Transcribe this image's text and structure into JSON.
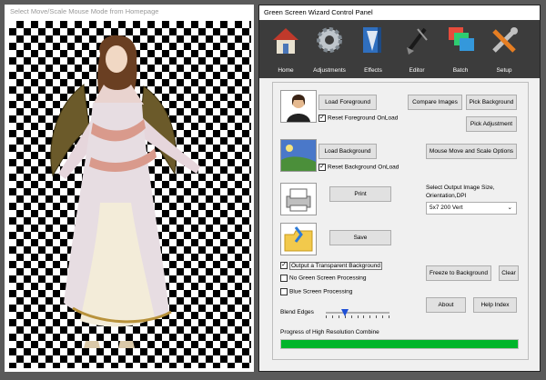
{
  "preview": {
    "title": "Select Move/Scale Mouse Mode from Homepage"
  },
  "panel": {
    "title": "Green Screen Wizard Control Panel",
    "toolbar": [
      {
        "label": "Home",
        "icon": "house-icon"
      },
      {
        "label": "Adjustments",
        "icon": "gear-icon"
      },
      {
        "label": "Effects",
        "icon": "effects-icon"
      },
      {
        "label": "Editor",
        "icon": "brush-icon"
      },
      {
        "label": "Batch",
        "icon": "batch-icon"
      },
      {
        "label": "Setup",
        "icon": "tools-icon"
      }
    ],
    "buttons": {
      "load_foreground": "Load Foreground",
      "compare_images": "Compare Images",
      "pick_background": "Pick Background",
      "pick_adjustment": "Pick Adjustment",
      "load_background": "Load Background",
      "mouse_move_scale": "Mouse Move and Scale Options",
      "print": "Print",
      "save": "Save",
      "freeze_to_background": "Freeze to Background",
      "clear": "Clear",
      "about": "About",
      "help_index": "Help Index"
    },
    "checkboxes": {
      "reset_foreground": {
        "label": "Reset Foreground OnLoad",
        "checked": true
      },
      "reset_background": {
        "label": "Reset Background OnLoad",
        "checked": true
      },
      "transparent_background": {
        "label": "Output a Transparent Background",
        "checked": true
      },
      "no_green_screen": {
        "label": "No Green Screen Processing",
        "checked": false
      },
      "blue_screen": {
        "label": "Blue Screen Processing",
        "checked": false
      }
    },
    "output_size_label": "Select Output Image Size, Orientation,DPI",
    "output_size_value": "5x7 200 Vert",
    "blend_edges_label": "Blend Edges",
    "blend_edges_level": 0.3,
    "progress_label": "Progress of High Resolution Combine",
    "progress_value": 1.0,
    "colors": {
      "progress": "#00b52a",
      "toolbar": "#3c3c3c"
    }
  }
}
